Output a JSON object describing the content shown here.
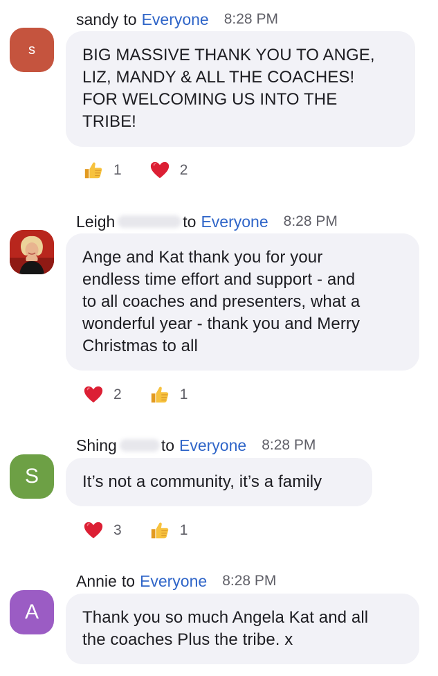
{
  "messages": [
    {
      "sender": "sandy",
      "to_label": "to",
      "target": "Everyone",
      "time": "8:28 PM",
      "avatar": {
        "letter": "s",
        "color": "#c5543e"
      },
      "lines": [
        "BIG MASSIVE THANK YOU TO ANGE,",
        "LIZ, MANDY & ALL THE COACHES!",
        "FOR WELCOMING US INTO THE",
        "TRIBE!"
      ],
      "reactions": [
        {
          "icon": "thumbs-up-icon",
          "count": "1"
        },
        {
          "icon": "heart-icon",
          "count": "2"
        }
      ]
    },
    {
      "sender": "Leigh",
      "to_label": "to",
      "target": "Everyone",
      "time": "8:28 PM",
      "avatar": {
        "photo": true,
        "color": "#b8261d"
      },
      "lines": [
        "Ange and Kat thank you for your",
        "endless time effort and support - and",
        "to all coaches and presenters, what a",
        "wonderful year - thank you and Merry",
        "Christmas to all"
      ],
      "reactions": [
        {
          "icon": "heart-icon",
          "count": "2"
        },
        {
          "icon": "thumbs-up-icon",
          "count": "1"
        }
      ]
    },
    {
      "sender": "Shing",
      "to_label": "to",
      "target": "Everyone",
      "time": "8:28 PM",
      "avatar": {
        "letter": "S",
        "color": "#6da045"
      },
      "lines": [
        "It’s not a community, it’s a family"
      ],
      "reactions": [
        {
          "icon": "heart-icon",
          "count": "3"
        },
        {
          "icon": "thumbs-up-icon",
          "count": "1"
        }
      ]
    },
    {
      "sender": "Annie",
      "to_label": "to",
      "target": "Everyone",
      "time": "8:28 PM",
      "avatar": {
        "letter": "A",
        "color": "#9b5cc4"
      },
      "lines": [
        "Thank you so much Angela Kat and all",
        "the coaches Plus the tribe. x"
      ],
      "reactions": []
    }
  ]
}
